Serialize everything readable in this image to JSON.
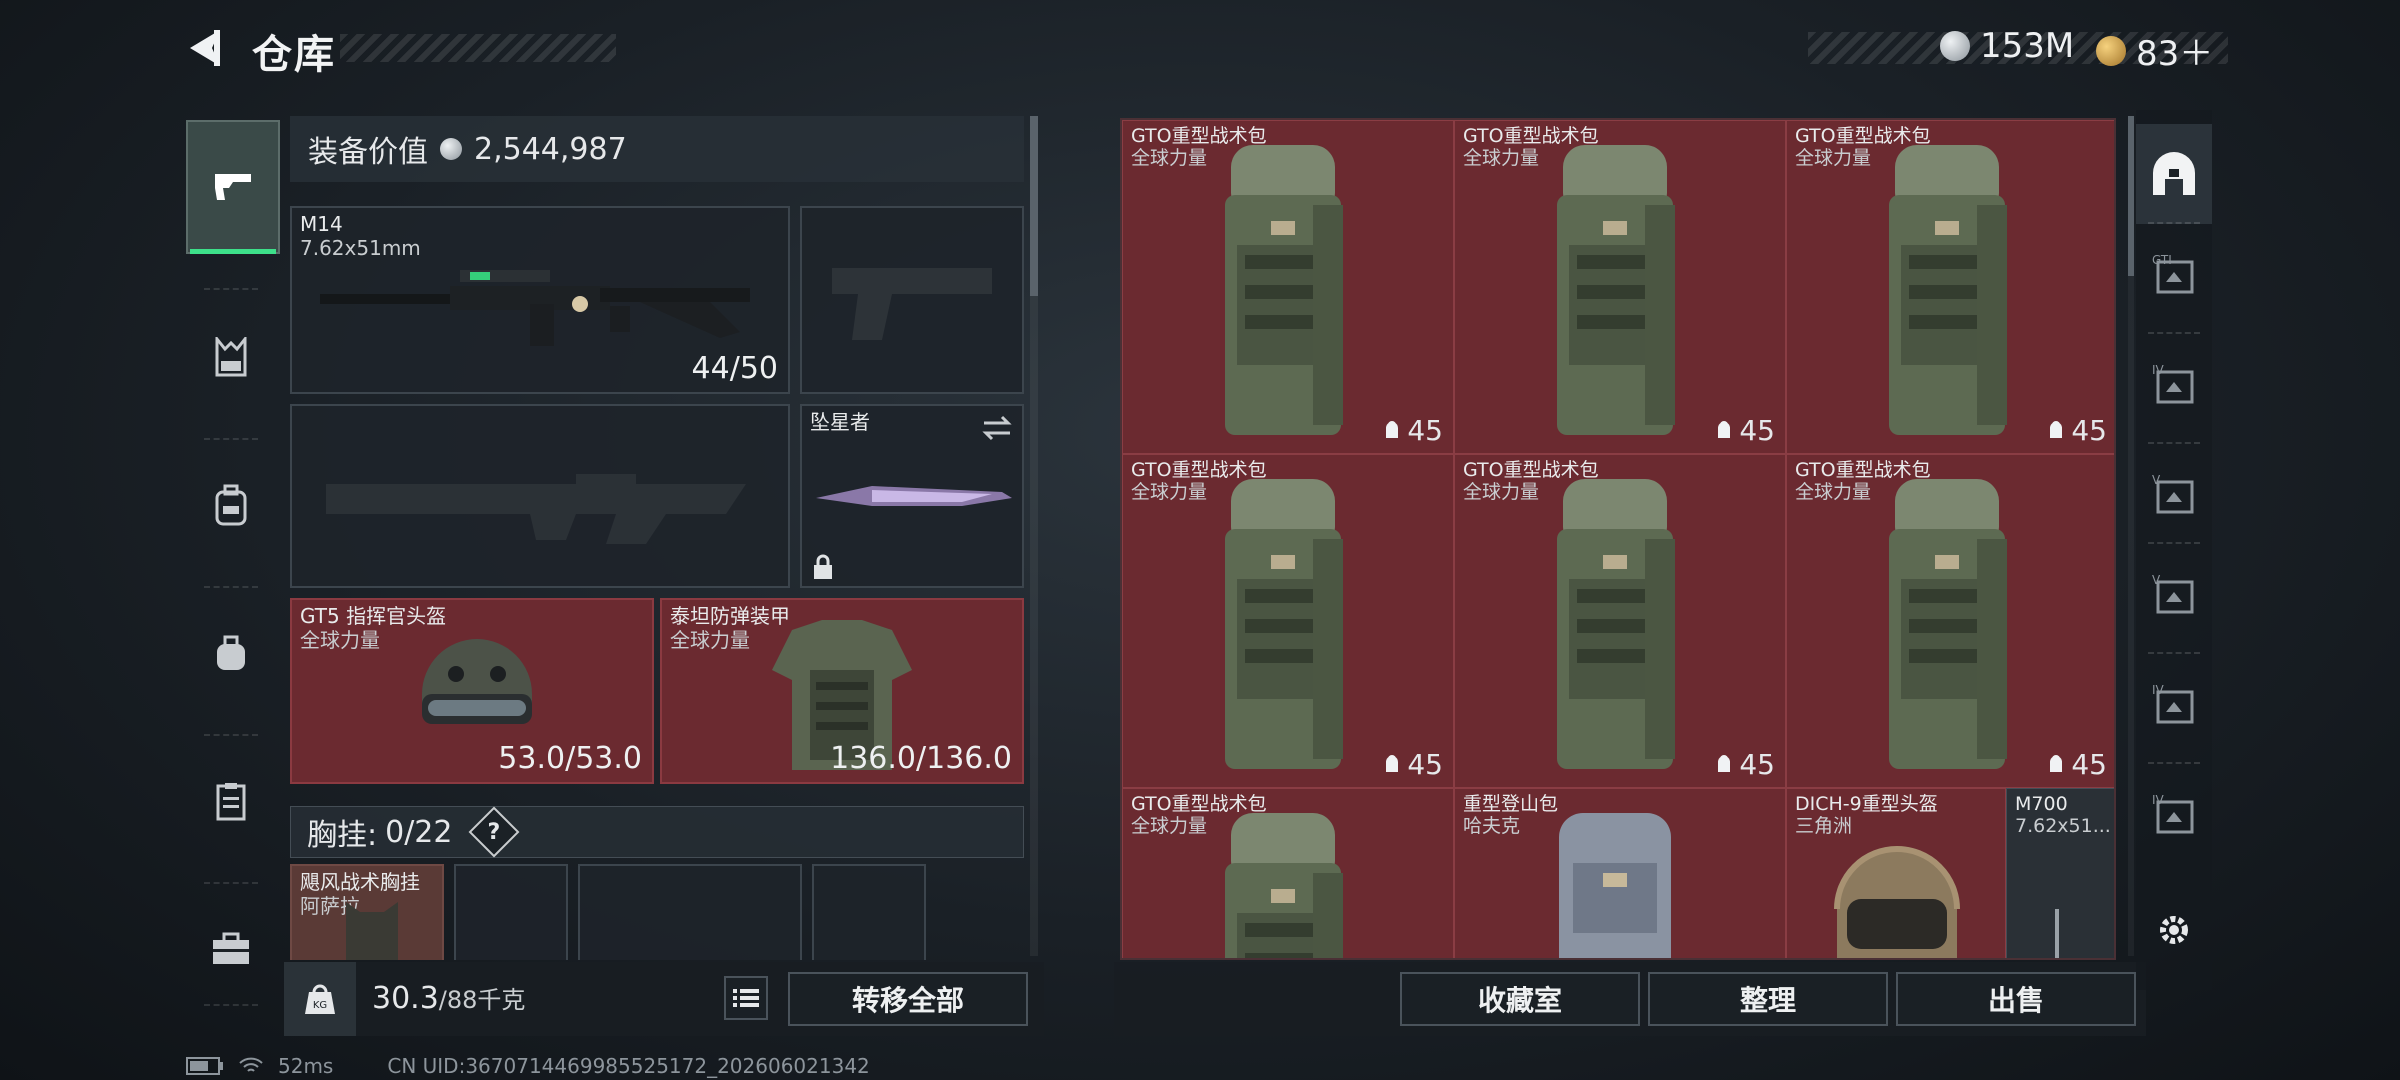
{
  "header": {
    "title": "仓库",
    "currencies": [
      {
        "value": "153M",
        "icon": "silver-coin-icon",
        "color": "#c9ced3"
      },
      {
        "value": "83＋",
        "icon": "gold-coin-icon",
        "color": "#d7a94a"
      }
    ]
  },
  "rail": {
    "items": [
      {
        "icon": "gun-icon",
        "active": true
      },
      {
        "icon": "chest-rig-icon"
      },
      {
        "icon": "backpack-icon"
      },
      {
        "icon": "bag-icon"
      },
      {
        "icon": "clipboard-icon"
      },
      {
        "icon": "briefcase-icon"
      }
    ]
  },
  "equipment": {
    "value_label": "装备价值",
    "value": "2,544,987",
    "primary": {
      "name": "M14",
      "caliber": "7.62x51mm",
      "ammo": "44/50"
    },
    "melee": {
      "name": "坠星者"
    },
    "helmet": {
      "name": "GT5 指挥官头盔",
      "faction": "全球力量",
      "durability": "53.0/53.0"
    },
    "armor": {
      "name": "泰坦防弹装甲",
      "faction": "全球力量",
      "durability": "136.0/136.0"
    },
    "vest_label": "胸挂:",
    "vest_count": "0/22",
    "vest_help": "?",
    "vest_item": {
      "name": "飓风战术胸挂",
      "faction": "阿萨拉"
    }
  },
  "footer_left": {
    "weight": "30.3",
    "capacity": "/88千克",
    "transfer_all": "转移全部"
  },
  "storage": {
    "items": [
      {
        "name": "GTO重型战术包",
        "faction": "全球力量",
        "qty": "45"
      },
      {
        "name": "GTO重型战术包",
        "faction": "全球力量",
        "qty": "45"
      },
      {
        "name": "GTO重型战术包",
        "faction": "全球力量",
        "qty": "45"
      },
      {
        "name": "GTO重型战术包",
        "faction": "全球力量",
        "qty": "45"
      },
      {
        "name": "GTO重型战术包",
        "faction": "全球力量",
        "qty": "45"
      },
      {
        "name": "GTO重型战术包",
        "faction": "全球力量",
        "qty": "45"
      },
      {
        "name": "GTO重型战术包",
        "faction": "全球力量"
      },
      {
        "name": "重型登山包",
        "faction": "哈夫克"
      },
      {
        "name": "DICH-9重型头盔",
        "faction": "三角洲"
      },
      {
        "name": "M700",
        "faction": "7.62x51..."
      }
    ]
  },
  "footer_right": {
    "collection": "收藏室",
    "organize": "整理",
    "sell": "出售"
  },
  "right_rail": {
    "items": [
      {
        "icon": "storage-tab-icon",
        "tag": ""
      },
      {
        "icon": "gti-container-icon",
        "tag": "GTI"
      },
      {
        "icon": "tier-iv-container-icon",
        "tag": "IV"
      },
      {
        "icon": "tier-v-key-icon",
        "tag": "V"
      },
      {
        "icon": "tier-v-container-icon",
        "tag": "V"
      },
      {
        "icon": "tier-iv-medkit-icon",
        "tag": "IV"
      },
      {
        "icon": "tier-iv-ammo-icon",
        "tag": "IV"
      },
      {
        "icon": "settings-icon",
        "tag": ""
      }
    ]
  },
  "status": {
    "ping": "52ms",
    "uid": "CN UID:3670714469985525172_202606021342"
  }
}
